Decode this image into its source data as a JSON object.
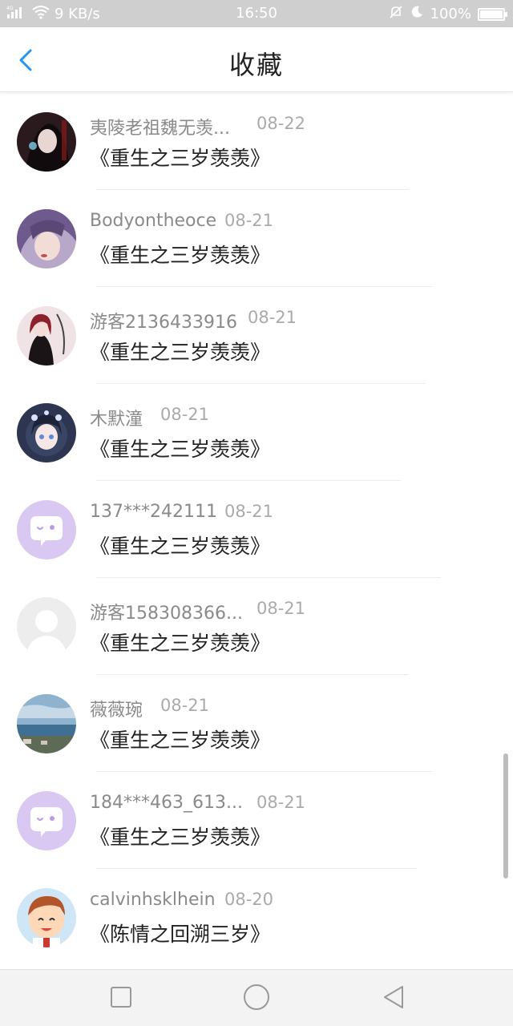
{
  "status_bar": {
    "network_speed": "9 KB/s",
    "time": "16:50",
    "battery": "100%",
    "battery_level": 1.0,
    "icons": [
      "signal-icon",
      "wifi-icon",
      "mute-bell-icon",
      "moon-icon",
      "battery-icon"
    ]
  },
  "header": {
    "title": "收藏",
    "back_icon": "back-arrow-icon",
    "accent_color": "#2196F3"
  },
  "favorites": [
    {
      "name": "夷陵老祖魏无羡...",
      "date": "08-22",
      "title": "《重生之三岁羡羡》",
      "avatar": "dark-anime-portrait"
    },
    {
      "name": "Bodyontheoce",
      "date": "08-21",
      "title": "《重生之三岁羡羡》",
      "avatar": "purple-hair-portrait"
    },
    {
      "name": "游客2136433916",
      "date": "08-21",
      "title": "《重生之三岁羡羡》",
      "avatar": "red-hair-girl-portrait"
    },
    {
      "name": "木默潼",
      "date": "08-21",
      "title": "《重生之三岁羡羡》",
      "avatar": "doll-girl-portrait"
    },
    {
      "name": "137***242111",
      "date": "08-21",
      "title": "《重生之三岁羡羡》",
      "avatar": "default-chat-bubble-avatar"
    },
    {
      "name": "游客158308366...",
      "date": "08-21",
      "title": "《重生之三岁羡羡》",
      "avatar": "default-grey-person-avatar"
    },
    {
      "name": "薇薇琬",
      "date": "08-21",
      "title": "《重生之三岁羡羡》",
      "avatar": "seaside-photo"
    },
    {
      "name": "184***463_613...",
      "date": "08-21",
      "title": "《重生之三岁羡羡》",
      "avatar": "default-chat-bubble-avatar"
    },
    {
      "name": "calvinhsklhein",
      "date": "08-20",
      "title": "《陈情之回溯三岁》",
      "avatar": "cartoon-boy-avatar"
    }
  ],
  "nav_bar": {
    "buttons": [
      "recents-square-icon",
      "home-circle-icon",
      "back-triangle-icon"
    ]
  }
}
